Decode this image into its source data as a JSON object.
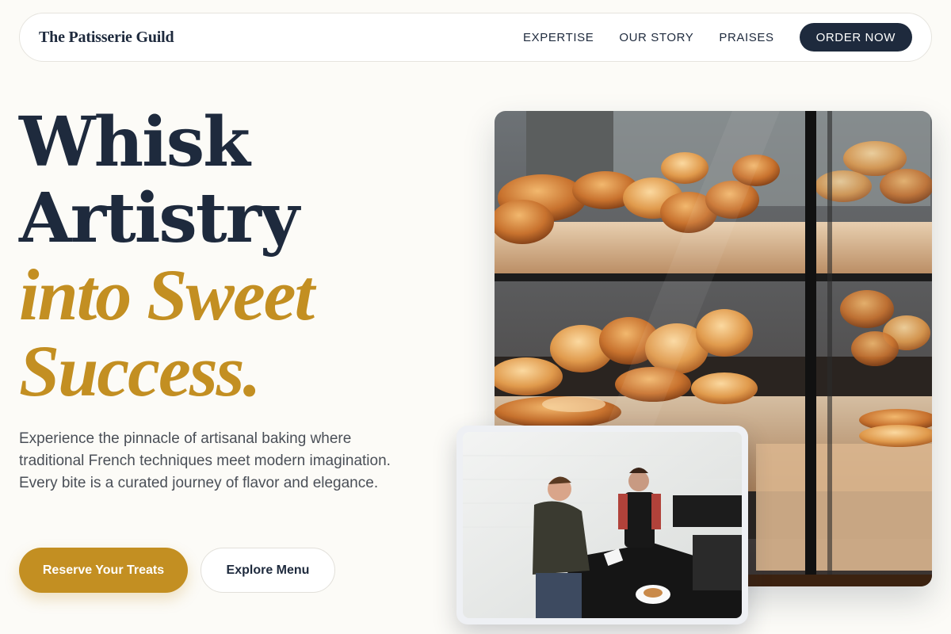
{
  "nav": {
    "brand": "The Patisserie Guild",
    "links": [
      "EXPERTISE",
      "OUR STORY",
      "PRAISES"
    ],
    "cta": "ORDER NOW"
  },
  "hero": {
    "line1": "Whisk",
    "line2": "Artistry",
    "line3": "into Sweet",
    "line4": "Success.",
    "description": "Experience the pinnacle of artisanal baking where traditional French techniques meet modern imagination. Every bite is a curated journey of flavor and elegance.",
    "primary_button": "Reserve Your Treats",
    "secondary_button": "Explore Menu"
  },
  "images": {
    "main": "bakery-display-case-photo",
    "secondary": "baker-serving-customer-photo"
  },
  "colors": {
    "navy": "#1e2a3d",
    "gold": "#c38f22",
    "background": "#fcfbf7"
  }
}
